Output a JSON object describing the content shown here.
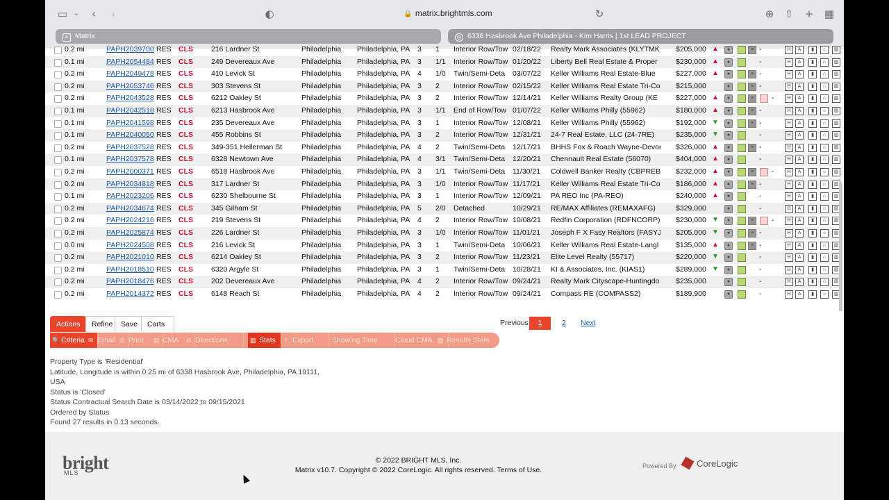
{
  "browser": {
    "url": "matrix.brightmls.com",
    "tabs": [
      {
        "label": "Matrix"
      },
      {
        "label": "6338 Hasbrook Ave Philadelphia - Kim Harris | 1st LEAD PROJECT"
      }
    ]
  },
  "results": {
    "rows": [
      {
        "dist": "0.2 mi",
        "mls": "PAPH2039700",
        "type": "RES",
        "status": "CLS",
        "address": "216 Lardner St",
        "city": "Philadelphia",
        "state": "Philadelphia, PA",
        "beds": "3",
        "baths": "1",
        "style": "Interior Row/Tow",
        "date": "02/18/22",
        "office": "Realty Mark Associates (KLYTMK",
        "price": "$205,000",
        "trend": "up",
        "icons": "full"
      },
      {
        "dist": "0.1 mi",
        "mls": "PAPH2054484",
        "type": "RES",
        "status": "CLS",
        "address": "249 Devereaux Ave",
        "city": "Philadelphia",
        "state": "Philadelphia, PA",
        "beds": "3",
        "baths": "1/1",
        "style": "Interior Row/Tow",
        "date": "01/20/22",
        "office": "Liberty Bell Real Estate & Proper",
        "price": "$230,000",
        "trend": "up",
        "icons": "basic"
      },
      {
        "dist": "0.2 mi",
        "mls": "PAPH2049478",
        "type": "RES",
        "status": "CLS",
        "address": "410 Levick St",
        "city": "Philadelphia",
        "state": "Philadelphia, PA",
        "beds": "4",
        "baths": "1/0",
        "style": "Twin/Semi-Deta",
        "date": "03/07/22",
        "office": "Keller Williams Real Estate-Blue",
        "price": "$227,000",
        "trend": "up",
        "icons": "doc"
      },
      {
        "dist": "0.2 mi",
        "mls": "PAPH2053746",
        "type": "RES",
        "status": "CLS",
        "address": "303 Stevens St",
        "city": "Philadelphia",
        "state": "Philadelphia, PA",
        "beds": "3",
        "baths": "2",
        "style": "Interior Row/Tow",
        "date": "02/15/22",
        "office": "Keller Williams Real Estate Tri-Co",
        "price": "$215,000",
        "trend": "",
        "icons": "doc"
      },
      {
        "dist": "0.2 mi",
        "mls": "PAPH2043528",
        "type": "RES",
        "status": "CLS",
        "address": "6212 Oakley St",
        "city": "Philadelphia",
        "state": "Philadelphia, PA",
        "beds": "3",
        "baths": "2",
        "style": "Interior Row/Tow",
        "date": "12/14/21",
        "office": "Keller Williams Realty Group (KE",
        "price": "$227,000",
        "trend": "up",
        "icons": "map"
      },
      {
        "dist": "0.1 mi",
        "mls": "PAPH2042518",
        "type": "RES",
        "status": "CLS",
        "address": "6213 Hasbrook Ave",
        "city": "Philadelphia",
        "state": "Philadelphia, PA",
        "beds": "3",
        "baths": "1/1",
        "style": "End of Row/Tow",
        "date": "01/07/22",
        "office": "Keller Williams Philly (55962)",
        "price": "$180,000",
        "trend": "up",
        "icons": "doc"
      },
      {
        "dist": "0.1 mi",
        "mls": "PAPH2041598",
        "type": "RES",
        "status": "CLS",
        "address": "235 Devereaux Ave",
        "city": "Philadelphia",
        "state": "Philadelphia, PA",
        "beds": "3",
        "baths": "1",
        "style": "Interior Row/Tow",
        "date": "12/08/21",
        "office": "Keller Williams Philly (55962)",
        "price": "$192,000",
        "trend": "down",
        "icons": "doc"
      },
      {
        "dist": "0.1 mi",
        "mls": "PAPH2040050",
        "type": "RES",
        "status": "CLS",
        "address": "455 Robbins St",
        "city": "Philadelphia",
        "state": "Philadelphia, PA",
        "beds": "3",
        "baths": "2",
        "style": "Interior Row/Tow",
        "date": "12/31/21",
        "office": "24-7 Real Estate, LLC (24-7RE)",
        "price": "$235,000",
        "trend": "down",
        "icons": "basic"
      },
      {
        "dist": "0.2 mi",
        "mls": "PAPH2037528",
        "type": "RES",
        "status": "CLS",
        "address": "349-351 Hellerman St",
        "city": "Philadelphia",
        "state": "Philadelphia, PA",
        "beds": "4",
        "baths": "2",
        "style": "Twin/Semi-Deta",
        "date": "12/17/21",
        "office": "BHHS Fox & Roach Wayne-Devor",
        "price": "$326,000",
        "trend": "up",
        "icons": "doc"
      },
      {
        "dist": "0.1 mi",
        "mls": "PAPH2037578",
        "type": "RES",
        "status": "CLS",
        "address": "6328 Newtown Ave",
        "city": "Philadelphia",
        "state": "Philadelphia, PA",
        "beds": "4",
        "baths": "3/1",
        "style": "Twin/Semi-Deta",
        "date": "12/20/21",
        "office": "Chennault Real Estate (56070)",
        "price": "$404,000",
        "trend": "up",
        "icons": "basic"
      },
      {
        "dist": "0.2 mi",
        "mls": "PAPH2000371",
        "type": "RES",
        "status": "CLS",
        "address": "6518 Hasbrook Ave",
        "city": "Philadelphia",
        "state": "Philadelphia, PA",
        "beds": "3",
        "baths": "1/1",
        "style": "Twin/Semi-Deta",
        "date": "11/30/21",
        "office": "Coldwell Banker Realty (CBPREB",
        "price": "$232,000",
        "trend": "up",
        "icons": "map"
      },
      {
        "dist": "0.2 mi",
        "mls": "PAPH2034818",
        "type": "RES",
        "status": "CLS",
        "address": "317 Lardner St",
        "city": "Philadelphia",
        "state": "Philadelphia, PA",
        "beds": "3",
        "baths": "1/0",
        "style": "Interior Row/Tow",
        "date": "11/17/21",
        "office": "Keller Williams Real Estate Tri-Co",
        "price": "$186,000",
        "trend": "up",
        "icons": "doc"
      },
      {
        "dist": "0.1 mi",
        "mls": "PAPH2023206",
        "type": "RES",
        "status": "CLS",
        "address": "6230 Shelbourne St",
        "city": "Philadelphia",
        "state": "Philadelphia, PA",
        "beds": "3",
        "baths": "1",
        "style": "Interior Row/Tow",
        "date": "12/09/21",
        "office": "PA REO Inc (PA-REO)",
        "price": "$240,000",
        "trend": "up",
        "icons": "basic"
      },
      {
        "dist": "0.2 mi",
        "mls": "PAPH2034674",
        "type": "RES",
        "status": "CLS",
        "address": "345 Gilham St",
        "city": "Philadelphia",
        "state": "Philadelphia, PA",
        "beds": "5",
        "baths": "2/0",
        "style": "Detached",
        "date": "10/29/21",
        "office": "RE/MAX Affiliates (REMAXAFG)",
        "price": "$329,000",
        "trend": "",
        "icons": "basic"
      },
      {
        "dist": "0.2 mi",
        "mls": "PAPH2024216",
        "type": "RES",
        "status": "CLS",
        "address": "219 Stevens St",
        "city": "Philadelphia",
        "state": "Philadelphia, PA",
        "beds": "4",
        "baths": "2",
        "style": "Interior Row/Tow",
        "date": "10/08/21",
        "office": "Redfin Corporation (RDFNCORP)",
        "price": "$230,000",
        "trend": "down",
        "icons": "map"
      },
      {
        "dist": "0.2 mi",
        "mls": "PAPH2025874",
        "type": "RES",
        "status": "CLS",
        "address": "226 Lardner St",
        "city": "Philadelphia",
        "state": "Philadelphia, PA",
        "beds": "3",
        "baths": "1/0",
        "style": "Interior Row/Tow",
        "date": "11/01/21",
        "office": "Joseph F X Fasy Realtors (FASYJ",
        "price": "$205,000",
        "trend": "down",
        "icons": "doc"
      },
      {
        "dist": "0.0 mi",
        "mls": "PAPH2024508",
        "type": "RES",
        "status": "CLS",
        "address": "216 Levick St",
        "city": "Philadelphia",
        "state": "Philadelphia, PA",
        "beds": "3",
        "baths": "1",
        "style": "Twin/Semi-Deta",
        "date": "10/06/21",
        "office": "Keller Williams Real Estate-Langl",
        "price": "$135,000",
        "trend": "up",
        "icons": "doc"
      },
      {
        "dist": "0.2 mi",
        "mls": "PAPH2021010",
        "type": "RES",
        "status": "CLS",
        "address": "6214 Oakley St",
        "city": "Philadelphia",
        "state": "Philadelphia, PA",
        "beds": "3",
        "baths": "2",
        "style": "Interior Row/Tow",
        "date": "11/23/21",
        "office": "Elite Level Realty (55717)",
        "price": "$220,000",
        "trend": "down",
        "icons": "basic"
      },
      {
        "dist": "0.2 mi",
        "mls": "PAPH2018510",
        "type": "RES",
        "status": "CLS",
        "address": "6320 Argyle St",
        "city": "Philadelphia",
        "state": "Philadelphia, PA",
        "beds": "3",
        "baths": "1",
        "style": "Twin/Semi-Deta",
        "date": "10/28/21",
        "office": "KI & Associates, Inc. (KIAS1)",
        "price": "$289,000",
        "trend": "down",
        "icons": "basic"
      },
      {
        "dist": "0.2 mi",
        "mls": "PAPH2018476",
        "type": "RES",
        "status": "CLS",
        "address": "202 Devereaux Ave",
        "city": "Philadelphia",
        "state": "Philadelphia, PA",
        "beds": "4",
        "baths": "2",
        "style": "Interior Row/Tow",
        "date": "09/24/21",
        "office": "Realty Mark Cityscape-Huntingdo",
        "price": "$235,000",
        "trend": "",
        "icons": "basic"
      },
      {
        "dist": "0.2 mi",
        "mls": "PAPH2014372",
        "type": "RES",
        "status": "CLS",
        "address": "6148 Reach St",
        "city": "Philadelphia",
        "state": "Philadelphia, PA",
        "beds": "4",
        "baths": "2",
        "style": "Interior Row/Tow",
        "date": "09/24/21",
        "office": "Compass RE (COMPASS2)",
        "price": "$189,900",
        "trend": "",
        "icons": "basic"
      }
    ],
    "dash": "-"
  },
  "actions": {
    "tabs": [
      "Actions",
      "Refine",
      "Save",
      "Carts"
    ],
    "tools": [
      "Criteria",
      "Email",
      "Print",
      "CMA",
      "Directions",
      "Stats",
      "Export",
      "Showing Time",
      "Cloud CMA",
      "Results Stats"
    ]
  },
  "pager": {
    "previous": "Previous",
    "current": "1",
    "page2": "2",
    "next": "Next"
  },
  "criteria": [
    "Property Type is 'Residential'",
    "Latitude, Longitude is within 0.25 mi of 6338 Hasbrook Ave, Philadelphia, PA 19111,",
    "USA",
    "Status is 'Closed'",
    "Status Contractual Search Date is 03/14/2022 to 09/15/2021",
    "Ordered by Status",
    "Found 27 results in 0.13 seconds."
  ],
  "footer": {
    "logo_main": "bright",
    "logo_sub": "MLS",
    "copyright1": "© 2022 BRIGHT MLS, Inc.",
    "copyright2": "Matrix v10.7. Copyright © 2022 CoreLogic. All rights reserved.",
    "terms": "Terms of Use.",
    "powered": "Powered By",
    "brand": "CoreLogic"
  },
  "colors": {
    "accent": "#e8452c",
    "link": "#1c5aa6",
    "closed": "#c8102e"
  }
}
